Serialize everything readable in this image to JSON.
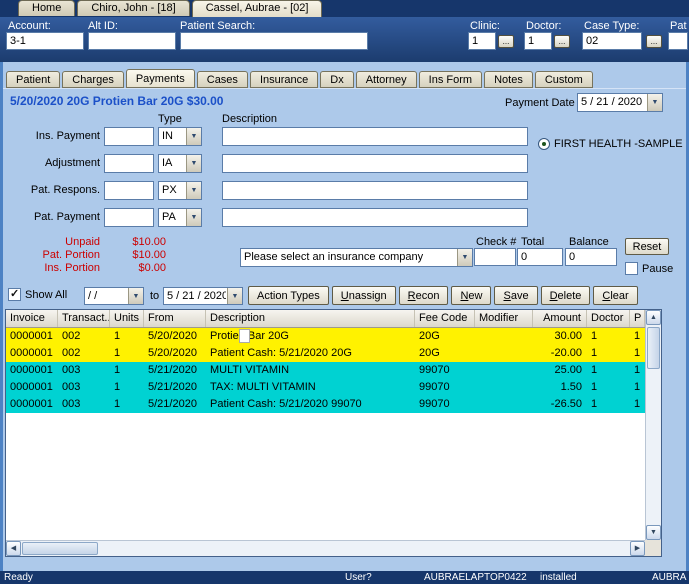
{
  "colors": {
    "highlight_yellow": "#FFF200",
    "highlight_cyan": "#00D2D2",
    "title_blue": "#1B50C8",
    "amount_red": "#CC0000",
    "topbar_navy": "#16366B"
  },
  "window": {
    "top_tabs": [
      {
        "label": "Home",
        "active": false
      },
      {
        "label": "Chiro, John - [18]",
        "active": false
      },
      {
        "label": "Cassel, Aubrae - [02]",
        "active": true
      }
    ]
  },
  "account_bar": {
    "account": {
      "label": "Account:",
      "value": "3-1"
    },
    "alt_id": {
      "label": "Alt ID:",
      "value": ""
    },
    "patient_search": {
      "label": "Patient Search:",
      "value": ""
    },
    "clinic": {
      "label": "Clinic:",
      "value": "1",
      "browse": "..."
    },
    "doctor": {
      "label": "Doctor:",
      "value": "1",
      "browse": "..."
    },
    "case_type": {
      "label": "Case Type:",
      "value": "02",
      "browse": "..."
    },
    "patient_type": {
      "label": "Pat",
      "value": ""
    }
  },
  "main_tabs": [
    {
      "label": "Patient",
      "active": false
    },
    {
      "label": "Charges",
      "active": false
    },
    {
      "label": "Payments",
      "active": true
    },
    {
      "label": "Cases",
      "active": false
    },
    {
      "label": "Insurance",
      "active": false
    },
    {
      "label": "Dx",
      "active": false
    },
    {
      "label": "Attorney",
      "active": false
    },
    {
      "label": "Ins Form",
      "active": false
    },
    {
      "label": "Notes",
      "active": false
    },
    {
      "label": "Custom",
      "active": false
    }
  ],
  "payment": {
    "title": "5/20/2020 20G Protien Bar 20G $30.00",
    "payment_date_label": "Payment Date",
    "payment_date": "5 / 21 / 2020",
    "col_type": "Type",
    "col_description": "Description",
    "rows": [
      {
        "label": "Ins. Payment",
        "amount": "",
        "type": "IN",
        "description": ""
      },
      {
        "label": "Adjustment",
        "amount": "",
        "type": "IA",
        "description": ""
      },
      {
        "label": "Pat. Respons.",
        "amount": "",
        "type": "PX",
        "description": ""
      },
      {
        "label": "Pat. Payment",
        "amount": "",
        "type": "PA",
        "description": ""
      }
    ],
    "insurance_option": "FIRST HEALTH -SAMPLE INS"
  },
  "totals": {
    "items": [
      {
        "label": "Unpaid",
        "value": "$10.00"
      },
      {
        "label": "Pat. Portion",
        "value": "$10.00"
      },
      {
        "label": "Ins. Portion",
        "value": "$0.00"
      }
    ],
    "insurance_select": "Please select an insurance company",
    "check_label": "Check #",
    "check_value": "",
    "total_label": "Total",
    "total_value": "0",
    "balance_label": "Balance",
    "balance_value": "0",
    "reset_button": "Reset",
    "pause_label": "Pause"
  },
  "filters": {
    "show_all": "Show All",
    "from_date": "/    /",
    "to_label": "to",
    "to_date": "5 / 21 / 2020",
    "buttons": [
      {
        "label": "Action Types",
        "u": -1
      },
      {
        "label": "Unassign",
        "u": 0
      },
      {
        "label": "Recon",
        "u": 0
      },
      {
        "label": "New",
        "u": 0
      },
      {
        "label": "Save",
        "u": 0
      },
      {
        "label": "Delete",
        "u": 0
      },
      {
        "label": "Clear",
        "u": 0
      }
    ]
  },
  "grid": {
    "columns": [
      {
        "label": "Invoice"
      },
      {
        "label": "Transact...",
        "sort": "asc"
      },
      {
        "label": "Units"
      },
      {
        "label": "From"
      },
      {
        "label": "Description"
      },
      {
        "label": "Fee Code"
      },
      {
        "label": "Modifier"
      },
      {
        "label": "Amount"
      },
      {
        "label": "Doctor"
      },
      {
        "label": "P"
      }
    ],
    "rows": [
      {
        "color": "yellow",
        "edit_box": true,
        "cells": [
          "0000001",
          "002",
          "1",
          "5/20/2020",
          "Protien Bar 20G",
          "20G",
          "",
          "30.00",
          "1",
          "1"
        ]
      },
      {
        "color": "yellow",
        "cells": [
          "0000001",
          "002",
          "1",
          "5/20/2020",
          "Patient Cash: 5/21/2020 20G",
          "20G",
          "",
          "-20.00",
          "1",
          "1"
        ]
      },
      {
        "color": "cyan",
        "cells": [
          "0000001",
          "003",
          "1",
          "5/21/2020",
          "MULTI VITAMIN",
          "99070",
          "",
          "25.00",
          "1",
          "1"
        ]
      },
      {
        "color": "cyan",
        "cells": [
          "0000001",
          "003",
          "1",
          "5/21/2020",
          "TAX: MULTI VITAMIN",
          "99070",
          "",
          "1.50",
          "1",
          "1"
        ]
      },
      {
        "color": "cyan",
        "cells": [
          "0000001",
          "003",
          "1",
          "5/21/2020",
          "Patient Cash: 5/21/2020 99070",
          "99070",
          "",
          "-26.50",
          "1",
          "1"
        ]
      }
    ]
  },
  "status_bar": {
    "left": "Ready",
    "items": [
      "User?",
      "AUBRAELAPTOP0422",
      "installed",
      "AUBRA"
    ]
  }
}
